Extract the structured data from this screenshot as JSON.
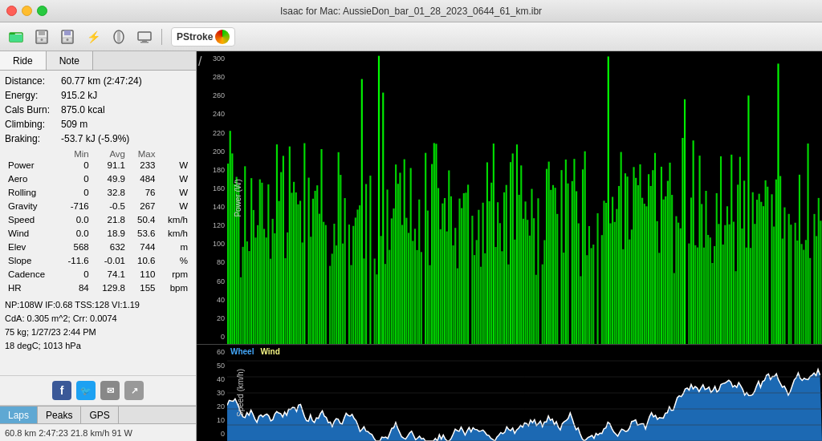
{
  "window": {
    "title": "Isaac for Mac:  AussieDon_bar_01_28_2023_0644_61_km.ibr"
  },
  "toolbar": {
    "buttons": [
      "open",
      "save-as",
      "save",
      "usb",
      "device",
      "screen"
    ],
    "badge_label": "PStroke"
  },
  "tabs": {
    "ride_label": "Ride",
    "note_label": "Note"
  },
  "stats": {
    "distance_label": "Distance:",
    "distance_value": "60.77 km (2:47:24)",
    "energy_label": "Energy:",
    "energy_value": "915.2 kJ",
    "cals_label": "Cals Burn:",
    "cals_value": "875.0 kcal",
    "climbing_label": "Climbing:",
    "climbing_value": "509 m",
    "braking_label": "Braking:",
    "braking_value": "-53.7 kJ (-5.9%)"
  },
  "metrics_table": {
    "headers": [
      "",
      "Min",
      "Avg",
      "Max",
      ""
    ],
    "rows": [
      {
        "label": "Power",
        "min": "0",
        "avg": "91.1",
        "max": "233",
        "unit": "W"
      },
      {
        "label": "Aero",
        "min": "0",
        "avg": "49.9",
        "max": "484",
        "unit": "W"
      },
      {
        "label": "Rolling",
        "min": "0",
        "avg": "32.8",
        "max": "76",
        "unit": "W"
      },
      {
        "label": "Gravity",
        "min": "-716",
        "avg": "-0.5",
        "max": "267",
        "unit": "W"
      },
      {
        "label": "Speed",
        "min": "0.0",
        "avg": "21.8",
        "max": "50.4",
        "unit": "km/h"
      },
      {
        "label": "Wind",
        "min": "0.0",
        "avg": "18.9",
        "max": "53.6",
        "unit": "km/h"
      },
      {
        "label": "Elev",
        "min": "568",
        "avg": "632",
        "max": "744",
        "unit": "m"
      },
      {
        "label": "Slope",
        "min": "-11.6",
        "avg": "-0.01",
        "max": "10.6",
        "unit": "%"
      },
      {
        "label": "Cadence",
        "min": "0",
        "avg": "74.1",
        "max": "110",
        "unit": "rpm"
      },
      {
        "label": "HR",
        "min": "84",
        "avg": "129.8",
        "max": "155",
        "unit": "bpm"
      }
    ]
  },
  "extra_stats": {
    "line1": "NP:108W IF:0.68 TSS:128 VI:1.19",
    "line2": "CdA: 0.305 m^2; Crr: 0.0074",
    "line3": "75 kg; 1/27/23 2:44 PM",
    "line4": "18 degC; 1013 hPa"
  },
  "bottom_tabs": {
    "laps_label": "Laps",
    "peaks_label": "Peaks",
    "gps_label": "GPS"
  },
  "status_bar": {
    "value": "60.8 km  2:47:23  21.8 km/h  91 W"
  },
  "power_chart": {
    "y_axis_label": "Power (W)",
    "y_ticks": [
      "300",
      "280",
      "260",
      "240",
      "220",
      "200",
      "180",
      "160",
      "140",
      "120",
      "100",
      "80",
      "60",
      "40",
      "20",
      "0"
    ],
    "slash_label": "/"
  },
  "speed_chart": {
    "y_axis_label": "Speed (km/h)",
    "y_ticks": [
      "60",
      "50",
      "40",
      "30",
      "20",
      "10",
      "0"
    ],
    "legend": [
      "Wheel",
      "Wind"
    ]
  }
}
